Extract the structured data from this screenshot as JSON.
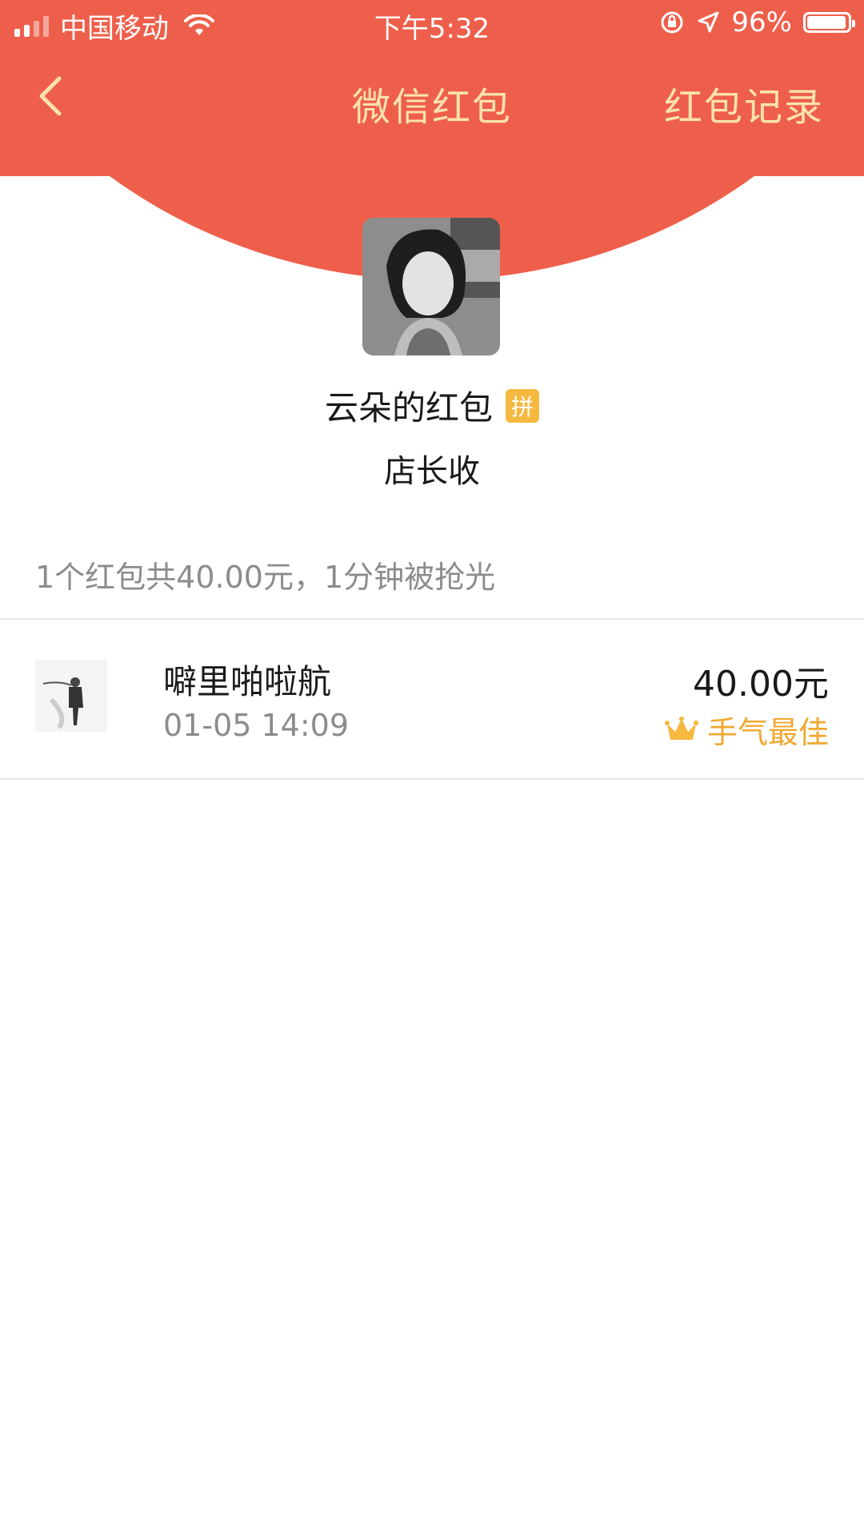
{
  "status_bar": {
    "carrier": "中国移动",
    "time": "下午5:32",
    "battery": "96%"
  },
  "nav": {
    "title": "微信红包",
    "record": "红包记录"
  },
  "packet": {
    "sender": "云朵的红包",
    "badge": "拼",
    "blessing": "店长收",
    "summary": "1个红包共40.00元，1分钟被抢光"
  },
  "records": [
    {
      "name": "噼里啪啦航",
      "time": "01-05 14:09",
      "amount": "40.00元",
      "tag": "手气最佳"
    }
  ],
  "colors": {
    "header_red": "#ee5f4b",
    "title_gold": "#fbe2ad",
    "best_luck_gold": "#f0a830"
  }
}
